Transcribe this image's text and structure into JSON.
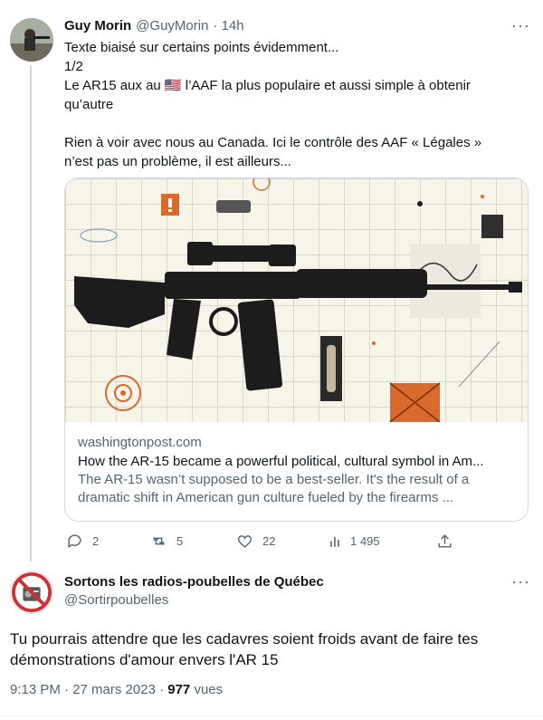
{
  "tweet1": {
    "name": "Guy Morin",
    "handle": "@GuyMorin",
    "time": "· 14h",
    "lines": [
      "Texte biaisé sur certains points évidemment...",
      "1/2",
      "Le AR15 aux au 🇺🇸 l’AAF la plus populaire et aussi simple à obtenir",
      "qu’autre",
      "",
      "Rien à voir avec nous au Canada. Ici le contrôle des AAF « Légales »",
      "n’est pas un problème, il est ailleurs..."
    ],
    "card": {
      "domain": "washingtonpost.com",
      "title": "How the AR-15 became a powerful political, cultural symbol in Am...",
      "desc1": "The AR-15 wasn’t supposed to be a best-seller. It's the result of a",
      "desc2": "dramatic shift in American gun culture fueled by the firearms ..."
    },
    "actions": {
      "replies": "2",
      "retweets": "5",
      "likes": "22",
      "views": "1 495"
    }
  },
  "tweet2": {
    "name": "Sortons les radios-poubelles de Québec",
    "handle": "@Sortirpoubelles",
    "text_line1": "Tu pourrais attendre que les cadavres soient froids avant de faire tes",
    "text_line2": "démonstrations d'amour envers l'AR 15",
    "timestamp": "9:13 PM · 27 mars 2023 · ",
    "views_count": "977",
    "views_label": " vues"
  },
  "colors": {
    "accent": "#1d9bf0",
    "muted": "#536471",
    "image_orange": "#d96a2b"
  }
}
